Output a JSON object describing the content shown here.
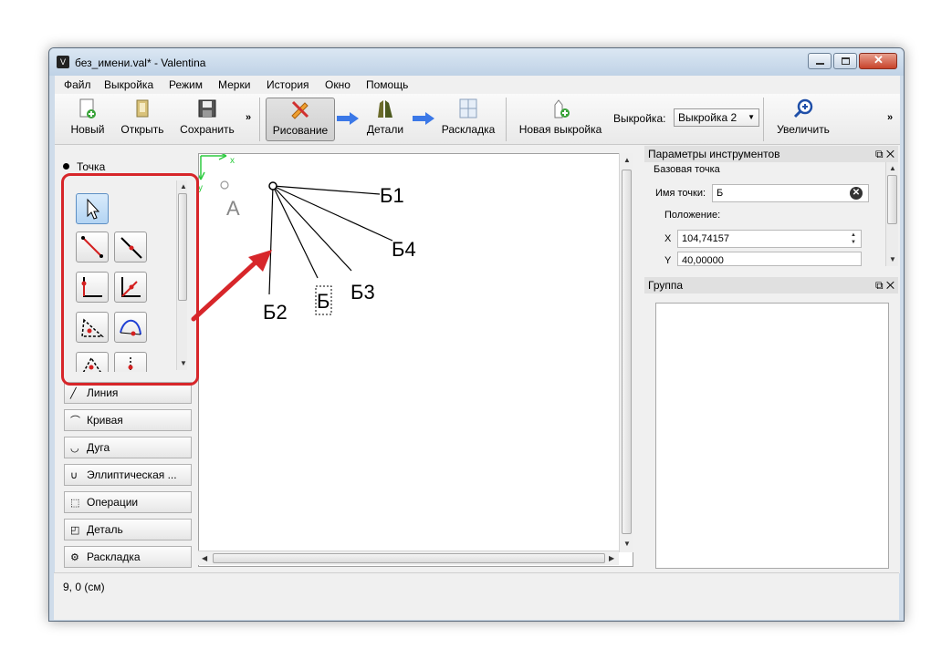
{
  "window": {
    "title": "без_имени.val* - Valentina",
    "app_icon": "V"
  },
  "menu": [
    "Файл",
    "Выкройка",
    "Режим",
    "Мерки",
    "История",
    "Окно",
    "Помощь"
  ],
  "toolbar": {
    "new_label": "Новый",
    "open_label": "Открыть",
    "save_label": "Сохранить",
    "draw_label": "Рисование",
    "details_label": "Детали",
    "layout_label": "Раскладка",
    "new_pattern_label": "Новая выкройка",
    "pattern_label": "Выкройка:",
    "pattern_value": "Выкройка 2",
    "zoom_label": "Увеличить",
    "overflow": "»"
  },
  "tools": {
    "point_header": "Точка",
    "categories": [
      "Линия",
      "Кривая",
      "Дуга",
      "Эллиптическая ...",
      "Операции",
      "Деталь",
      "Раскладка"
    ]
  },
  "canvas": {
    "point_a": "А",
    "point_b": "Б",
    "point_b1": "Б1",
    "point_b2": "Б2",
    "point_b3": "Б3",
    "point_b4": "Б4",
    "axis_x": "x",
    "axis_y": "y"
  },
  "tool_options": {
    "title": "Параметры инструментов",
    "section": "Базовая точка",
    "name_label": "Имя точки:",
    "name_value": "Б",
    "position_label": "Положение:",
    "x_label": "X",
    "x_value": "104,74157",
    "y_label": "Y",
    "y_value": "40,00000",
    "dock_buttons": "⧉ ✕"
  },
  "group": {
    "title": "Группа",
    "dock_buttons": "⧉ ✕"
  },
  "status": {
    "coords": "9, 0 (см)"
  },
  "colors": {
    "highlight_red": "#d7262a",
    "accent_blue": "#3b78e7"
  }
}
